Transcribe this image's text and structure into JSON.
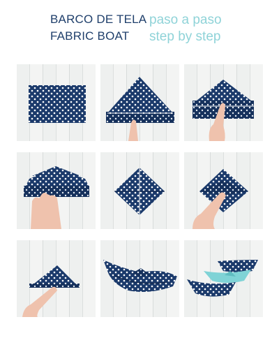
{
  "header": {
    "line1_es": "BARCO DE TELA",
    "line1_es_sub": "paso a paso",
    "line2_en": "FABRIC BOAT",
    "line2_en_sub": "step by step"
  },
  "colors": {
    "fabric_navy": "#1b3a6b",
    "dots": "#ffffff",
    "teal_boat": "#7fd3d6",
    "title_dark": "#1f3f6b",
    "title_light": "#8fd3d8",
    "wood_bg": "#eef0ef",
    "skin": "#efc2ad"
  },
  "steps": [
    "step-1",
    "step-2",
    "step-3",
    "step-4",
    "step-5",
    "step-6",
    "step-7",
    "step-8",
    "step-9"
  ]
}
